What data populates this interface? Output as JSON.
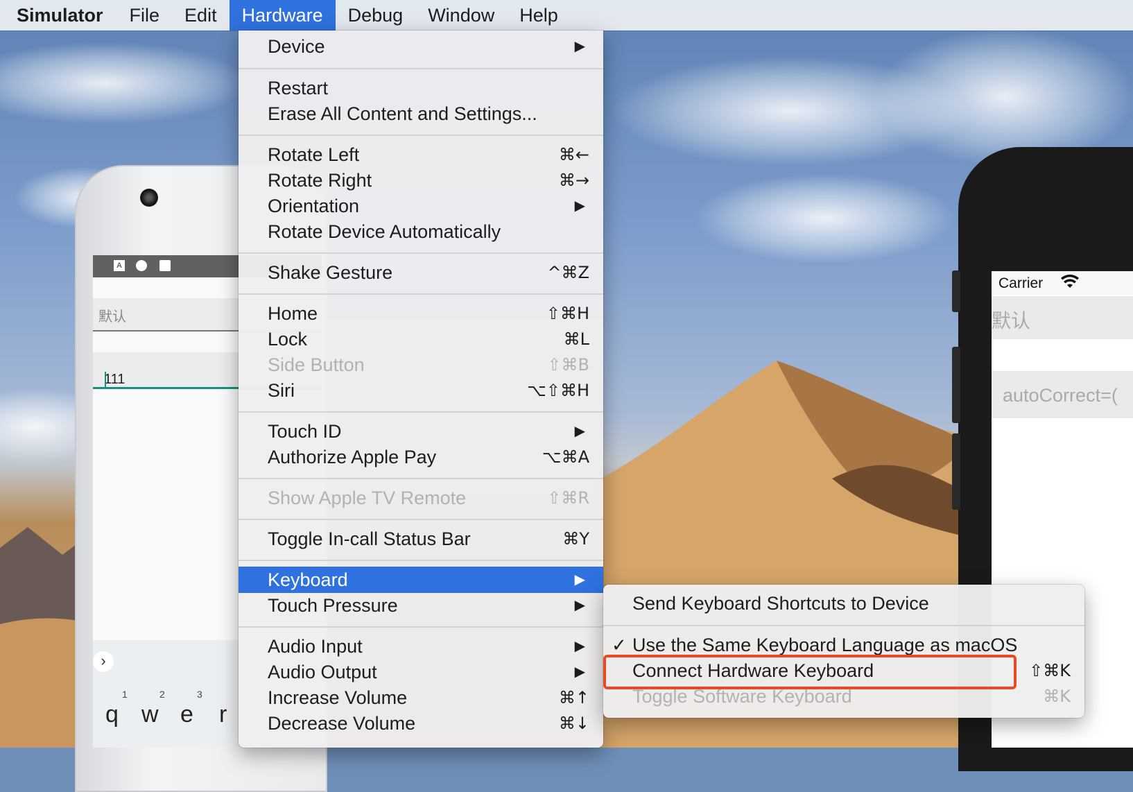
{
  "menubar": {
    "app_name": "Simulator",
    "items": [
      "File",
      "Edit",
      "Hardware",
      "Debug",
      "Window",
      "Help"
    ],
    "active_item": "Hardware"
  },
  "hardware_menu": {
    "items": [
      {
        "label": "Device",
        "submenu": true
      },
      {
        "label": "Restart"
      },
      {
        "label": "Erase All Content and Settings..."
      },
      {
        "label": "Rotate Left",
        "shortcut": "⌘←"
      },
      {
        "label": "Rotate Right",
        "shortcut": "⌘→"
      },
      {
        "label": "Orientation",
        "submenu": true
      },
      {
        "label": "Rotate Device Automatically"
      },
      {
        "label": "Shake Gesture",
        "shortcut": "^⌘Z"
      },
      {
        "label": "Home",
        "shortcut": "⇧⌘H"
      },
      {
        "label": "Lock",
        "shortcut": "⌘L"
      },
      {
        "label": "Side Button",
        "shortcut": "⇧⌘B",
        "disabled": true
      },
      {
        "label": "Siri",
        "shortcut": "⌥⇧⌘H"
      },
      {
        "label": "Touch ID",
        "submenu": true
      },
      {
        "label": "Authorize Apple Pay",
        "shortcut": "⌥⌘A"
      },
      {
        "label": "Show Apple TV Remote",
        "shortcut": "⇧⌘R",
        "disabled": true
      },
      {
        "label": "Toggle In-call Status Bar",
        "shortcut": "⌘Y"
      },
      {
        "label": "Keyboard",
        "submenu": true,
        "highlighted": true
      },
      {
        "label": "Touch Pressure",
        "submenu": true
      },
      {
        "label": "Audio Input",
        "submenu": true
      },
      {
        "label": "Audio Output",
        "submenu": true
      },
      {
        "label": "Increase Volume",
        "shortcut": "⌘↑"
      },
      {
        "label": "Decrease Volume",
        "shortcut": "⌘↓"
      }
    ],
    "submenu_arrow": "▶"
  },
  "keyboard_submenu": {
    "items": [
      {
        "label": "Send Keyboard Shortcuts to Device"
      },
      {
        "label": "Use the Same Keyboard Language as macOS",
        "checked": true
      },
      {
        "label": "Connect Hardware Keyboard",
        "shortcut": "⇧⌘K",
        "callout": true
      },
      {
        "label": "Toggle Software Keyboard",
        "shortcut": "⌘K",
        "disabled": true
      }
    ],
    "checkmark": "✓"
  },
  "android_device": {
    "status_icons": [
      "A"
    ],
    "field1_hint": "默认",
    "field2_value": "111",
    "keyboard_chevron": "›",
    "keys": [
      "q",
      "w",
      "e",
      "r"
    ],
    "key_numbers": [
      "1",
      "2",
      "3"
    ]
  },
  "iphone_device": {
    "carrier": "Carrier",
    "wifi_icon": "wifi-icon",
    "field1_placeholder": "默认",
    "field2_placeholder": "autoCorrect=("
  },
  "colors": {
    "menu_highlight": "#2f71df",
    "callout_border": "#e84a24",
    "android_accent": "#16907e"
  }
}
